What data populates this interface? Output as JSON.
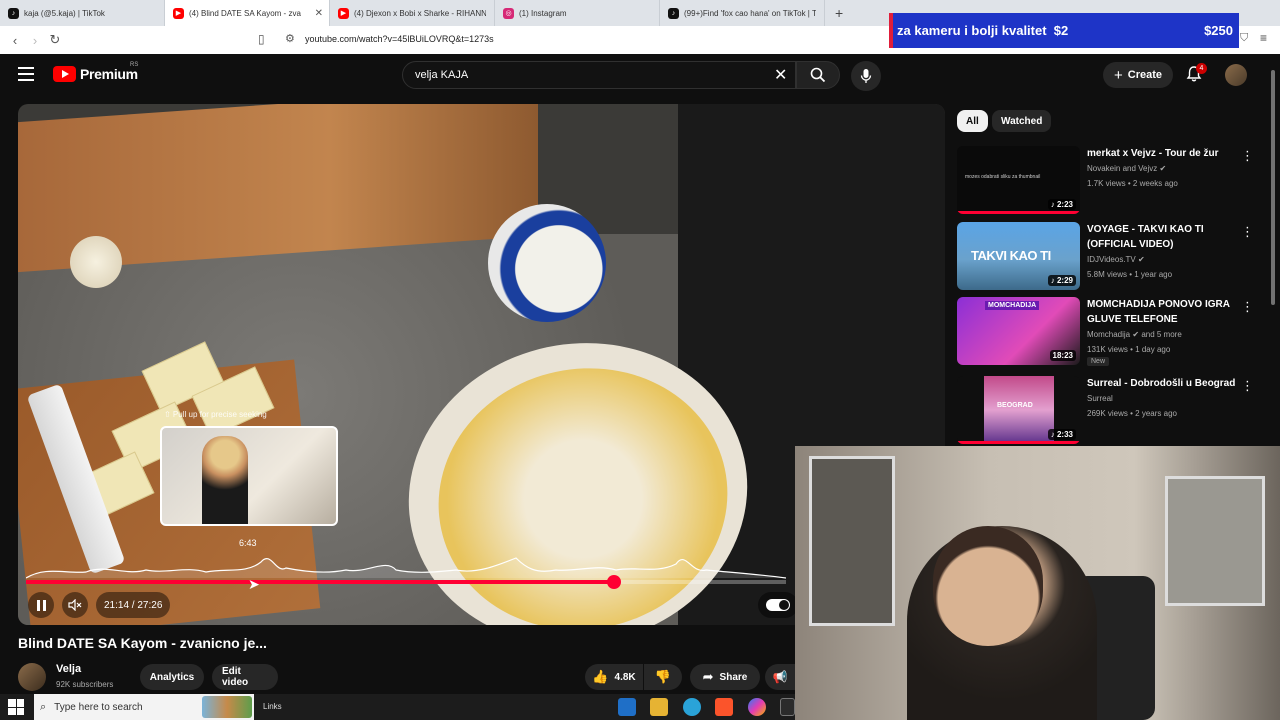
{
  "browser": {
    "tabs": [
      {
        "title": "kaja (@5.kaja) | TikTok",
        "icon": "tiktok-icon",
        "color": "#111111"
      },
      {
        "title": "(4) Blind DATE SA Kayom - zvan",
        "icon": "youtube-icon",
        "color": "#ff0000",
        "active": true
      },
      {
        "title": "(4) Djexon x Bobi x Sharke - RIHANN",
        "icon": "youtube-icon",
        "color": "#ff0000"
      },
      {
        "title": "(1) Instagram",
        "icon": "instagram-icon",
        "color": "#d62976"
      },
      {
        "title": "(99+)Find 'fox cao hana' on TikTok | T",
        "icon": "tiktok-icon",
        "color": "#111111"
      }
    ],
    "new_tab": "+",
    "url": "youtube.com/watch?v=45lBUiLOVRQ&t=1273s"
  },
  "promo": {
    "text": "za kameru i bolji kvalitet",
    "amount_left": "$2",
    "amount_right": "$250"
  },
  "header": {
    "logo_text": "Premium",
    "region": "RS",
    "search_value": "velja KAJA",
    "create_label": "Create",
    "notifications": "4"
  },
  "player": {
    "seek_hint": "⇧ Pull up for precise seeking",
    "preview_time": "6:43",
    "time": "21:14 / 27:26",
    "progress": 0.774,
    "hover_position": 0.245
  },
  "video": {
    "title": "Blind DATE SA Kayom - zvanicno je...",
    "channel": "Velja",
    "subscribers": "92K subscribers",
    "analytics_label": "Analytics",
    "edit_label": "Edit video",
    "likes": "4.8K",
    "share_label": "Share"
  },
  "sidebar": {
    "chips": [
      "All",
      "Watched"
    ],
    "items": [
      {
        "title": "merkat x Vejvz - Tour de žur",
        "channel": "Novakein and Vejvz",
        "verified": true,
        "meta": "1.7K views • 2 weeks ago",
        "duration": "2:23",
        "thumb_text": "mozes odabrati sliku za thumbnail"
      },
      {
        "title": "VOYAGE - TAKVI KAO TI (OFFICIAL VIDEO)",
        "channel": "IDJVideos.TV",
        "verified": true,
        "meta": "5.8M views • 1 year ago",
        "duration": "2:29",
        "thumb_text": "TAKVI KAO TI"
      },
      {
        "title": "MOMCHADIJA PONOVO IGRA GLUVE TELEFONE",
        "channel": "Momchadija",
        "verified": true,
        "channel_extra": "and 5 more",
        "meta": "131K views • 1 day ago",
        "duration": "18:23",
        "badge": "New",
        "thumb_text": "MOMCHADIJA"
      },
      {
        "title": "Surreal - Dobrodošli u Beograd",
        "channel": "Surreal",
        "verified": false,
        "meta": "269K views • 2 years ago",
        "duration": "2:33",
        "thumb_text": "BEOGRAD"
      }
    ]
  },
  "taskbar": {
    "search_placeholder": "Type here to search",
    "links_label": "Links"
  },
  "colors": {
    "accent": "#ff0033",
    "background": "#0f0f0f",
    "promo": "#1e34c7"
  }
}
